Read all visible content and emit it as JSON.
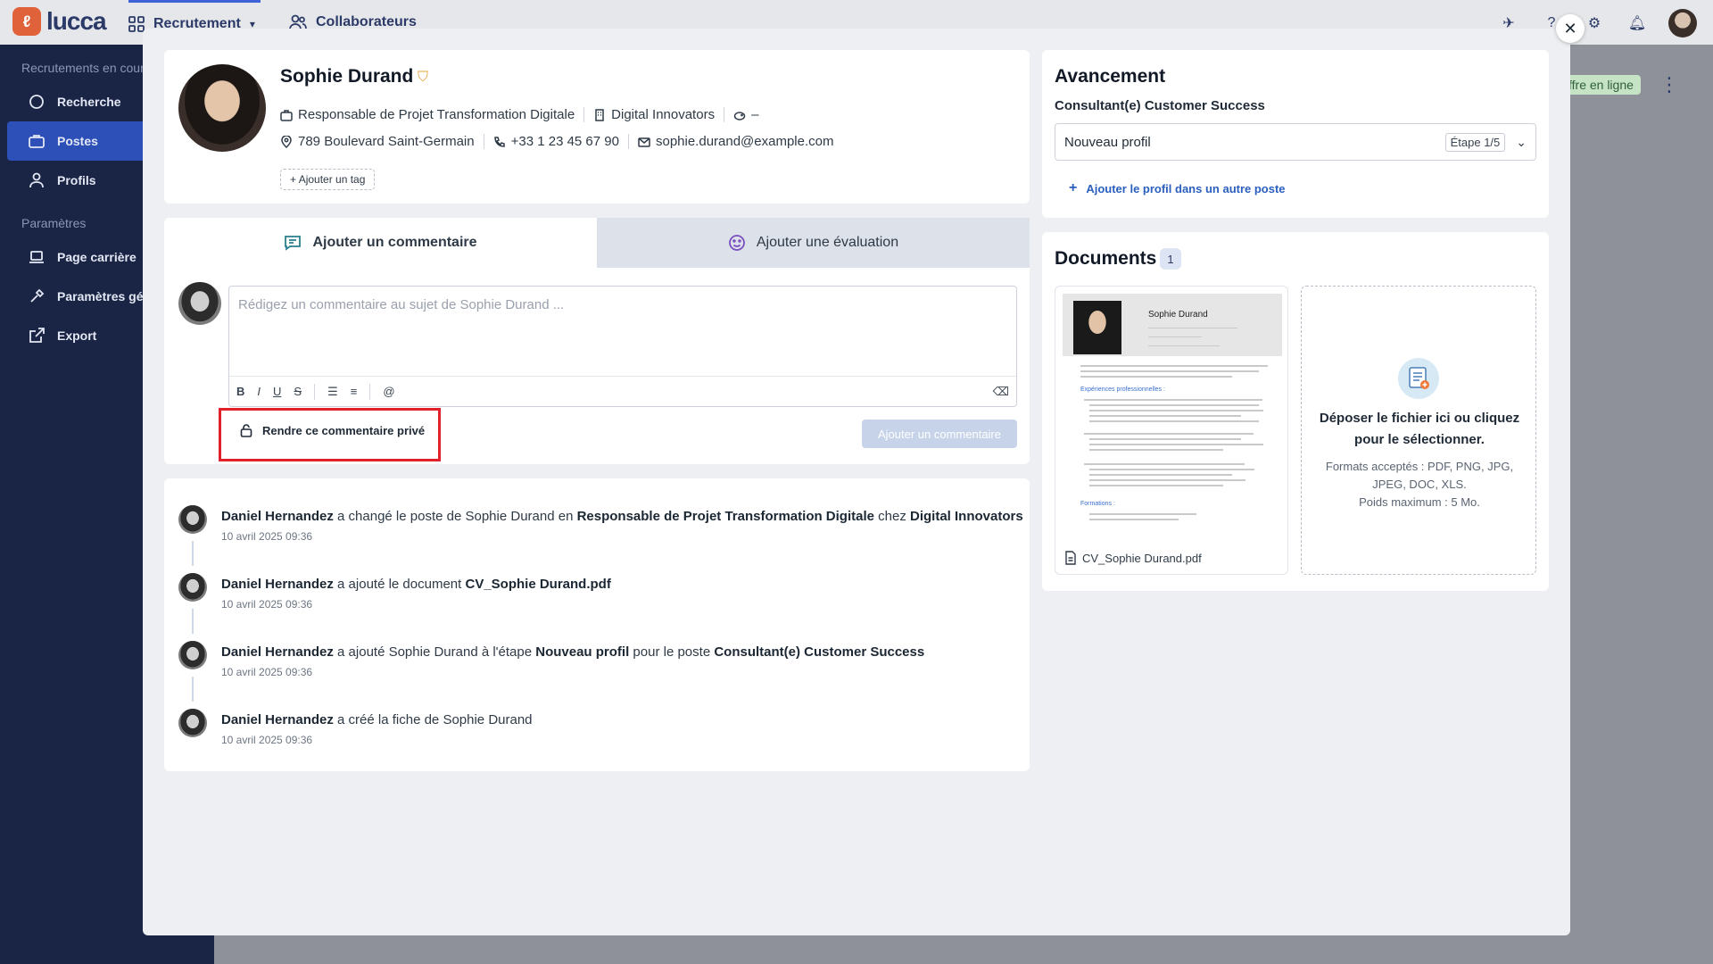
{
  "topbar": {
    "brand": "lucca",
    "nav": [
      {
        "label": "Recrutement",
        "active": true
      },
      {
        "label": "Collaborateurs",
        "active": false
      }
    ]
  },
  "sidebar": {
    "section_recruit": "Recrutements en cours",
    "items_recruit": [
      {
        "label": "Recherche",
        "icon": "search-icon",
        "active": false
      },
      {
        "label": "Postes",
        "icon": "briefcase-icon",
        "active": true
      },
      {
        "label": "Profils",
        "icon": "user-icon",
        "active": false
      }
    ],
    "section_settings": "Paramètres",
    "items_settings": [
      {
        "label": "Page carrière",
        "icon": "laptop-icon"
      },
      {
        "label": "Paramètres génér",
        "icon": "tools-icon"
      },
      {
        "label": "Export",
        "icon": "external-link-icon"
      }
    ]
  },
  "background": {
    "chip": "ffre en ligne"
  },
  "profile": {
    "name": "Sophie Durand",
    "job_title": "Responsable de Projet Transformation Digitale",
    "company": "Digital Innovators",
    "salary": "–",
    "address": "789 Boulevard Saint-Germain",
    "phone": "+33 1 23 45 67 90",
    "email": "sophie.durand@example.com",
    "add_tag": "Ajouter un tag"
  },
  "composer": {
    "tab_comment": "Ajouter un commentaire",
    "tab_evaluation": "Ajouter une évaluation",
    "placeholder": "Rédigez un commentaire au sujet de Sophie Durand ...",
    "toolbar": {
      "bold": "B",
      "italic": "I",
      "underline": "U",
      "strike": "S",
      "mention": "@"
    },
    "private_label": "Rendre ce commentaire privé",
    "submit_label": "Ajouter un commentaire"
  },
  "activity": [
    {
      "actor": "Daniel Hernandez",
      "parts": [
        " a changé le poste de Sophie Durand en ",
        "Responsable de Projet Transformation Digitale",
        " chez ",
        "Digital Innovators",
        ""
      ],
      "date": "10 avril 2025 09:36"
    },
    {
      "actor": "Daniel Hernandez",
      "parts": [
        " a ajouté le document ",
        "CV_Sophie Durand.pdf",
        "",
        "",
        ""
      ],
      "date": "10 avril 2025 09:36"
    },
    {
      "actor": "Daniel Hernandez",
      "parts": [
        " a ajouté Sophie Durand à l'étape ",
        "Nouveau profil",
        " pour le poste ",
        "Consultant(e) Customer Success",
        ""
      ],
      "date": "10 avril 2025 09:36"
    },
    {
      "actor": "Daniel Hernandez",
      "parts": [
        " a créé la fiche de Sophie Durand",
        "",
        "",
        "",
        ""
      ],
      "date": "10 avril 2025 09:36"
    }
  ],
  "progress": {
    "title": "Avancement",
    "job": "Consultant(e) Customer Success",
    "stage": "Nouveau profil",
    "stage_step": "Étape 1/5",
    "add_link": "Ajouter le profil dans un autre poste"
  },
  "documents": {
    "title": "Documents",
    "count": "1",
    "file_name": "CV_Sophie Durand.pdf",
    "cv_name": "Sophie Durand",
    "cv_section_1": "Expériences professionnelles :",
    "cv_section_2": "Formations :",
    "drop_title": "Déposer le fichier ici ou cliquez pour le sélectionner.",
    "drop_formats": "Formats acceptés : PDF, PNG, JPG, JPEG, DOC, XLS.",
    "drop_max": "Poids maximum : 5 Mo."
  },
  "colors": {
    "sidebar_bg": "#1a2546",
    "accent": "#2d4fb8",
    "highlight_box": "#e0202a",
    "link": "#2a5fbf"
  }
}
